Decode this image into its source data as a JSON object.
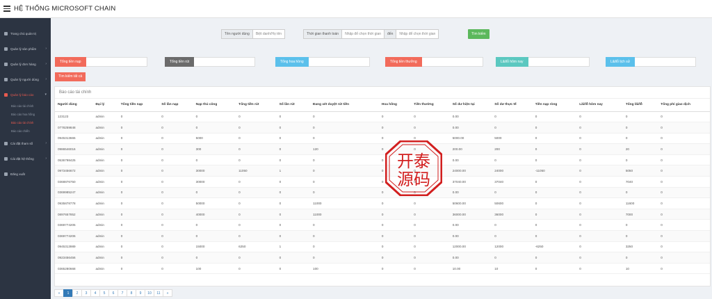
{
  "app": {
    "title": "HỆ THỐNG MICROSOFT CHAIN"
  },
  "sidebar": {
    "items": [
      {
        "label": "Trang chủ quản trị"
      },
      {
        "label": "Quản lý sản phẩm"
      },
      {
        "label": "Quản lý đơn hàng"
      },
      {
        "label": "Quản lý người dùng"
      },
      {
        "label": "Quản lý báo cáo"
      },
      {
        "label": "Cài đặt tham số"
      },
      {
        "label": "Cài đặt hệ thống"
      },
      {
        "label": "Đăng xuất"
      }
    ],
    "sub": [
      {
        "label": "Báo cáo tài chính"
      },
      {
        "label": "Báo cáo hoa hồng"
      },
      {
        "label": "Báo cáo tài chính"
      },
      {
        "label": "Báo cáo chiến"
      }
    ]
  },
  "filters": {
    "user_label": "Tên người dùng",
    "user_placeholder": "Biệt danh/Họ tên",
    "time_label": "Thời gian thanh toán",
    "start_placeholder": "Nhập để chọn thời gian",
    "to_label": "đến",
    "end_placeholder": "Nhập để chọn thời gian",
    "search_label": "Tìm kiếm"
  },
  "stats": [
    {
      "label": "Tổng tiền nạp",
      "value": "",
      "color": "#f26b5b"
    },
    {
      "label": "Tổng tiền rút",
      "value": "",
      "color": "#6b6b6b"
    },
    {
      "label": "Tổng hoa hồng",
      "value": "",
      "color": "#5bc0eb"
    },
    {
      "label": "Tổng tiền thưởng",
      "value": "",
      "color": "#f26b5b"
    },
    {
      "label": "Lãi/lỗ hôm nay",
      "value": "",
      "color": "#5bc8c0"
    },
    {
      "label": "Lãi/lỗ lịch sử",
      "value": "",
      "color": "#5bc0eb"
    }
  ],
  "reset_label": "Tìm kiếm tất cả",
  "panel": {
    "title": "Báo cáo tài chính"
  },
  "table": {
    "columns": [
      "Người dùng",
      "Đại lý",
      "Tổng tiền nạp",
      "Số lần nạp",
      "Nạp thủ công",
      "Tổng tiền rút",
      "Số lần rút",
      "Đang xét duyệt rút tiền",
      "Hoa hồng",
      "Tiền thưởng",
      "Số dư hiện tại",
      "Số dư thực tế",
      "Tiền nạp ròng",
      "Lãi/lỗ hôm nay",
      "Tổng lãi/lỗ",
      "Tổng phí giao dịch"
    ],
    "rows": [
      [
        "123123",
        "admin",
        "0",
        "0",
        "0",
        "0",
        "0",
        "0",
        "0",
        "0",
        "0.00",
        "0",
        "0",
        "0",
        "0",
        "0"
      ],
      [
        "0778259848",
        "admin",
        "0",
        "0",
        "0",
        "0",
        "0",
        "0",
        "0",
        "0",
        "0.00",
        "0",
        "0",
        "0",
        "0",
        "0"
      ],
      [
        "0945313665",
        "admin",
        "0",
        "0",
        "5000",
        "0",
        "0",
        "0",
        "0",
        "0",
        "5000.00",
        "5000",
        "0",
        "0",
        "0",
        "0"
      ],
      [
        "0986546016",
        "admin",
        "0",
        "0",
        "300",
        "0",
        "0",
        "120",
        "0",
        "0",
        "200.00",
        "200",
        "0",
        "0",
        "20",
        "0"
      ],
      [
        "0536798425",
        "admin",
        "0",
        "0",
        "0",
        "0",
        "0",
        "0",
        "0",
        "0",
        "0.00",
        "0",
        "0",
        "0",
        "0",
        "0"
      ],
      [
        "0973456672",
        "admin",
        "0",
        "0",
        "30000",
        "11050",
        "1",
        "0",
        "0",
        "0",
        "24000.00",
        "24000",
        "-11050",
        "0",
        "5050",
        "0"
      ],
      [
        "0368876750",
        "admin",
        "0",
        "0",
        "30000",
        "0",
        "0",
        "0",
        "0",
        "0",
        "37040.00",
        "37040",
        "0",
        "0",
        "7040",
        "0"
      ],
      [
        "0369985247",
        "admin",
        "0",
        "0",
        "0",
        "0",
        "0",
        "0",
        "0",
        "0",
        "0.00",
        "0",
        "0",
        "0",
        "0",
        "0"
      ],
      [
        "0935878778",
        "admin",
        "0",
        "0",
        "50000",
        "0",
        "0",
        "11000",
        "0",
        "0",
        "50600.00",
        "50600",
        "0",
        "0",
        "11600",
        "0"
      ],
      [
        "0897657852",
        "admin",
        "0",
        "0",
        "40000",
        "0",
        "0",
        "11000",
        "0",
        "0",
        "36000.00",
        "36000",
        "0",
        "0",
        "7000",
        "0"
      ],
      [
        "0369774205",
        "admin",
        "0",
        "0",
        "0",
        "0",
        "0",
        "0",
        "0",
        "0",
        "0.00",
        "0",
        "0",
        "0",
        "0",
        "0"
      ],
      [
        "0369774206",
        "admin",
        "0",
        "0",
        "0",
        "0",
        "0",
        "0",
        "0",
        "0",
        "0.00",
        "0",
        "0",
        "0",
        "0",
        "0"
      ],
      [
        "0945313989",
        "admin",
        "0",
        "0",
        "15000",
        "6250",
        "1",
        "0",
        "0",
        "0",
        "12000.00",
        "12000",
        "-6250",
        "0",
        "3250",
        "0"
      ],
      [
        "0923456456",
        "admin",
        "0",
        "0",
        "0",
        "0",
        "0",
        "0",
        "0",
        "0",
        "0.00",
        "0",
        "0",
        "0",
        "0",
        "0"
      ],
      [
        "0365280668",
        "admin",
        "0",
        "0",
        "100",
        "0",
        "0",
        "100",
        "0",
        "0",
        "10.00",
        "10",
        "0",
        "0",
        "10",
        "0"
      ]
    ]
  },
  "pagination": {
    "pages": [
      "«",
      "1",
      "2",
      "3",
      "4",
      "5",
      "6",
      "7",
      "8",
      "9",
      "10",
      "11",
      "»"
    ],
    "current": "1"
  },
  "seal": {
    "line1": "开泰",
    "line2": "源码",
    "color": "#d21f1f"
  }
}
